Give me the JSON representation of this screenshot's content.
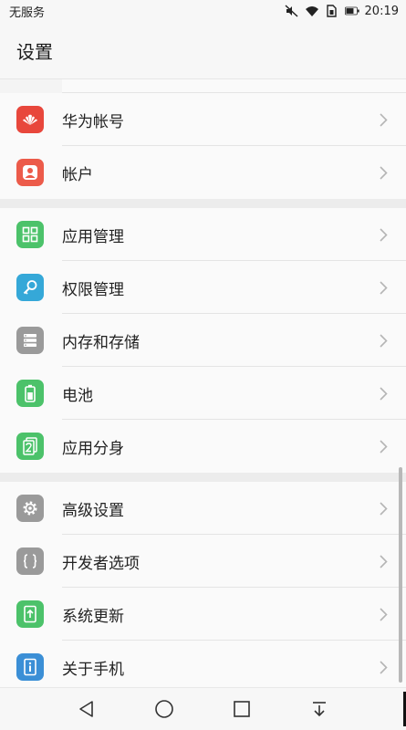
{
  "status_bar": {
    "carrier": "无服务",
    "time": "20:19",
    "icons": [
      "mute-icon",
      "wifi-icon",
      "sim-icon",
      "battery-icon"
    ]
  },
  "header": {
    "title": "设置"
  },
  "sections": [
    {
      "items": [
        {
          "label": "华为帐号",
          "icon": "huawei-logo-icon",
          "color": "#e8473c"
        },
        {
          "label": "帐户",
          "icon": "user-icon",
          "color": "#ec5b4a"
        }
      ]
    },
    {
      "items": [
        {
          "label": "应用管理",
          "icon": "apps-grid-icon",
          "color": "#4cc26a"
        },
        {
          "label": "权限管理",
          "icon": "key-icon",
          "color": "#35a8d8"
        },
        {
          "label": "内存和存储",
          "icon": "storage-icon",
          "color": "#9a9a9a"
        },
        {
          "label": "电池",
          "icon": "battery-icon",
          "color": "#4cc26a"
        },
        {
          "label": "应用分身",
          "icon": "app-twin-icon",
          "color": "#4cc26a"
        }
      ]
    },
    {
      "items": [
        {
          "label": "高级设置",
          "icon": "gear-icon",
          "color": "#9a9a9a"
        },
        {
          "label": "开发者选项",
          "icon": "braces-icon",
          "color": "#9a9a9a"
        },
        {
          "label": "系统更新",
          "icon": "system-update-icon",
          "color": "#4cc26a"
        },
        {
          "label": "关于手机",
          "icon": "info-icon",
          "color": "#3b8fd6"
        }
      ]
    }
  ],
  "nav_bar": {
    "buttons": [
      "back-icon",
      "home-icon",
      "recents-icon",
      "notification-pull-icon"
    ]
  }
}
